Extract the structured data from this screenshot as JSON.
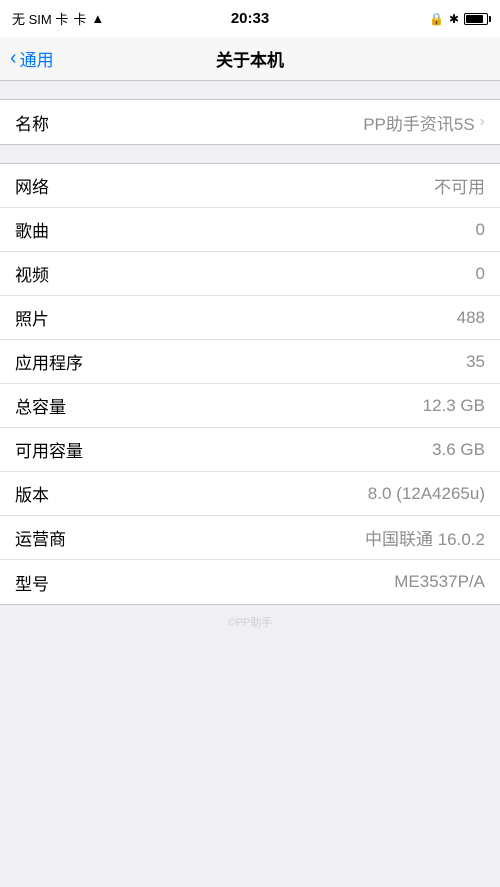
{
  "statusBar": {
    "carrier": "无 SIM 卡",
    "wifi": "WiFi",
    "time": "20:33",
    "lock": "🔒",
    "bluetooth": "✱"
  },
  "navBar": {
    "backLabel": "通用",
    "title": "关于本机"
  },
  "rows": [
    {
      "label": "名称",
      "value": "PP助手资讯5S",
      "hasChevron": true
    },
    {
      "label": "网络",
      "value": "不可用",
      "hasChevron": false
    },
    {
      "label": "歌曲",
      "value": "0",
      "hasChevron": false
    },
    {
      "label": "视频",
      "value": "0",
      "hasChevron": false
    },
    {
      "label": "照片",
      "value": "488",
      "hasChevron": false
    },
    {
      "label": "应用程序",
      "value": "35",
      "hasChevron": false
    },
    {
      "label": "总容量",
      "value": "12.3 GB",
      "hasChevron": false
    },
    {
      "label": "可用容量",
      "value": "3.6 GB",
      "hasChevron": false
    },
    {
      "label": "版本",
      "value": "8.0 (12A4265u)",
      "hasChevron": false
    },
    {
      "label": "运营商",
      "value": "中国联通 16.0.2",
      "hasChevron": false
    },
    {
      "label": "型号",
      "value": "ME3537P/A",
      "hasChevron": false
    }
  ]
}
